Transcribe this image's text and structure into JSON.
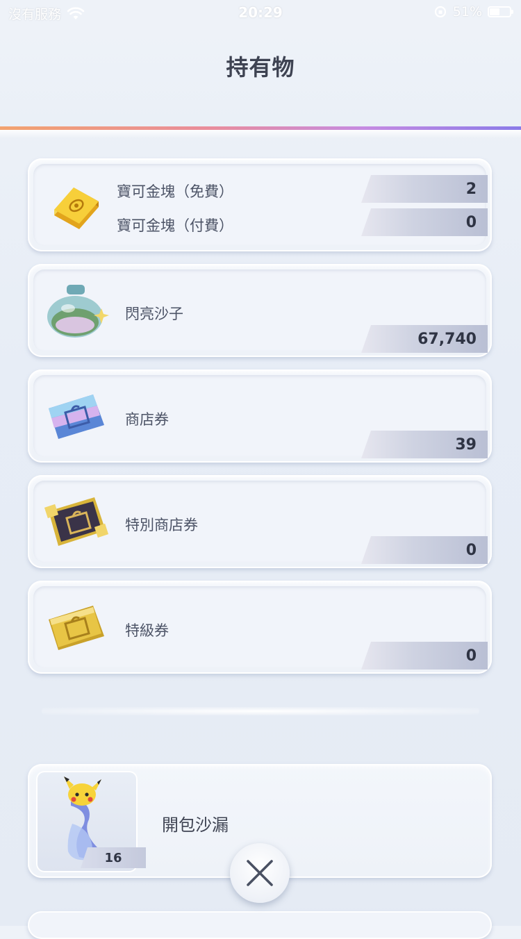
{
  "status_bar": {
    "carrier": "沒有服務",
    "time": "20:29",
    "battery_text": "51%",
    "battery_level": 0.51
  },
  "header": {
    "title": "持有物"
  },
  "items": [
    {
      "label_free": "寶可金塊（免費）",
      "value_free": "2",
      "label_paid": "寶可金塊（付費）",
      "value_paid": "0",
      "icon": "gold-bar-icon"
    },
    {
      "label": "閃亮沙子",
      "value": "67,740",
      "icon": "shiny-sand-bottle-icon"
    },
    {
      "label": "商店券",
      "value": "39",
      "icon": "shop-ticket-icon"
    },
    {
      "label": "特別商店券",
      "value": "0",
      "icon": "special-shop-ticket-icon"
    },
    {
      "label": "特級券",
      "value": "0",
      "icon": "premium-ticket-icon"
    }
  ],
  "hourglass": {
    "label": "開包沙漏",
    "count": "16",
    "icon": "pikachu-hourglass-icon"
  },
  "close_button": {
    "icon": "close-icon"
  }
}
